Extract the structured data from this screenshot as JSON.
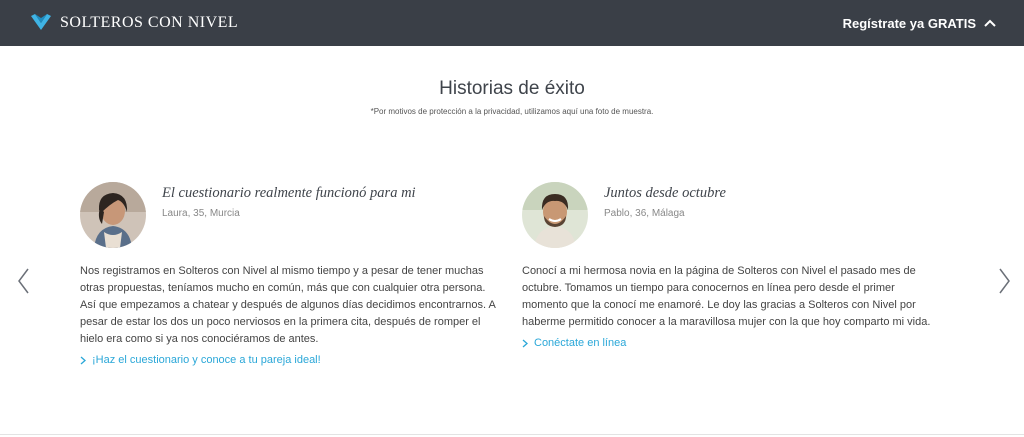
{
  "header": {
    "logo_text": "SOLTEROS CON NIVEL",
    "cta_label": "Regístrate ya GRATIS"
  },
  "section": {
    "title": "Historias de éxito",
    "note": "*Por motivos de protección a la privacidad, utilizamos aquí una foto de muestra."
  },
  "stories": [
    {
      "title": "El cuestionario realmente funcionó para mi",
      "meta": "Laura, 35, Murcia",
      "text": "Nos registramos en Solteros con Nivel al mismo tiempo y a pesar de tener muchas otras propuestas, teníamos mucho en común, más que con cualquier otra persona. Así que empezamos a chatear y después de algunos días decidimos encontrarnos. A pesar de estar los dos un poco nerviosos en la primera cita, después de romper el hielo era como si ya nos conociéramos de antes.",
      "link": "¡Haz el cuestionario y conoce a tu pareja ideal!"
    },
    {
      "title": "Juntos desde octubre",
      "meta": "Pablo, 36, Málaga",
      "text": "Conocí a mi hermosa novia en la página de Solteros con Nivel el pasado mes de octubre. Tomamos un tiempo para conocernos en línea pero desde el primer momento que la conocí me enamoré. Le doy las gracias a Solteros con Nivel por haberme permitido conocer a la maravillosa mujer con la que hoy comparto mi vida.",
      "link": "Conéctate en línea"
    }
  ],
  "colors": {
    "header_bg": "#3a3f47",
    "accent": "#2aa7d8",
    "logo_blue": "#3fb4e5"
  },
  "icons": {
    "logo": "heart-check-logo-icon",
    "cta": "chevron-up-icon",
    "prev": "chevron-left-icon",
    "next": "chevron-right-icon",
    "link": "chevron-right-small-icon"
  }
}
